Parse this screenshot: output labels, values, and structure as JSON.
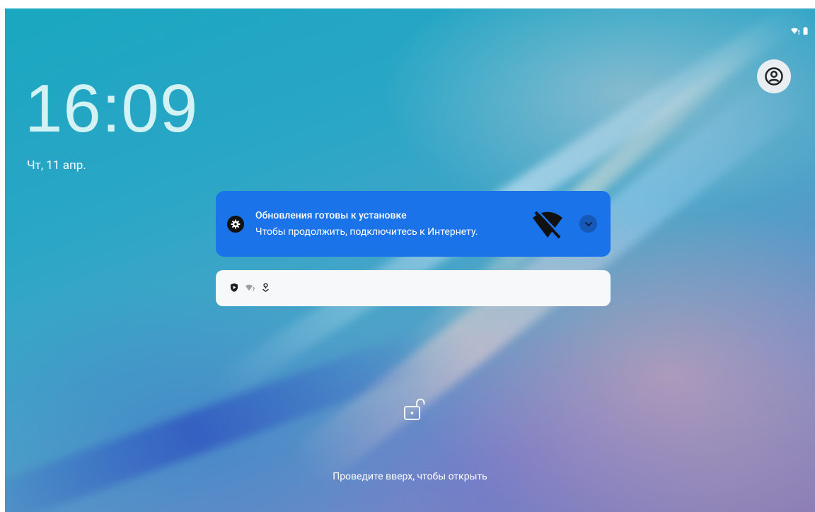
{
  "lockscreen": {
    "time": "16:09",
    "date": "Чт, 11 апр.",
    "swipe_hint": "Проведите вверх, чтобы открыть"
  },
  "status_bar": {
    "icons": [
      "wifi-no-internet-icon",
      "battery-icon"
    ]
  },
  "user_switcher": {
    "icon": "account-circle-icon"
  },
  "notification": {
    "app_icon": "settings-gear-icon",
    "title": "Обновления готовы к установке",
    "text": "Чтобы продолжить, подключитесь к Интернету.",
    "large_icon": "wifi-off-icon",
    "expand_icon": "chevron-down-icon",
    "background_color": "#1a73e8"
  },
  "notification_shelf": {
    "icons": [
      "play-protect-icon",
      "wifi-no-internet-icon",
      "location-icon"
    ]
  },
  "lock_icon": "unlocked-icon"
}
